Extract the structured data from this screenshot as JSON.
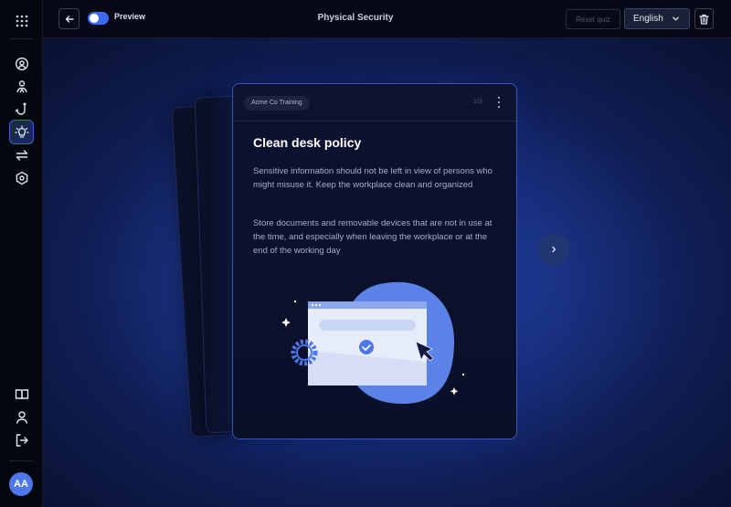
{
  "topbar": {
    "preview_label": "Preview",
    "title": "Physical Security",
    "reset_label": "Reset quiz",
    "language": "English"
  },
  "sidebar": {
    "top_icons": [
      "grid-icon",
      "dashboard-icon",
      "people-icon",
      "phishing-hook-icon",
      "lightbulb-icon",
      "sync-icon",
      "settings-icon"
    ],
    "bottom_icons": [
      "book-icon",
      "user-icon",
      "logout-icon"
    ],
    "active": "lightbulb-icon",
    "avatar_initials": "AA"
  },
  "card": {
    "tag": "Acme Co Training",
    "page_indicator": "1/3",
    "title": "Clean desk policy",
    "paragraph_1": "Sensitive information should not be left in view of persons who might misuse it. Keep the workplace clean and organized",
    "paragraph_2": "Store documents and removable devices that are not in use at the time, and especially when leaving the workplace or at the end of the working day"
  },
  "colors": {
    "accent": "#3d6bf0",
    "blob": "#5b82e6",
    "card_border": "#3a55b5"
  }
}
